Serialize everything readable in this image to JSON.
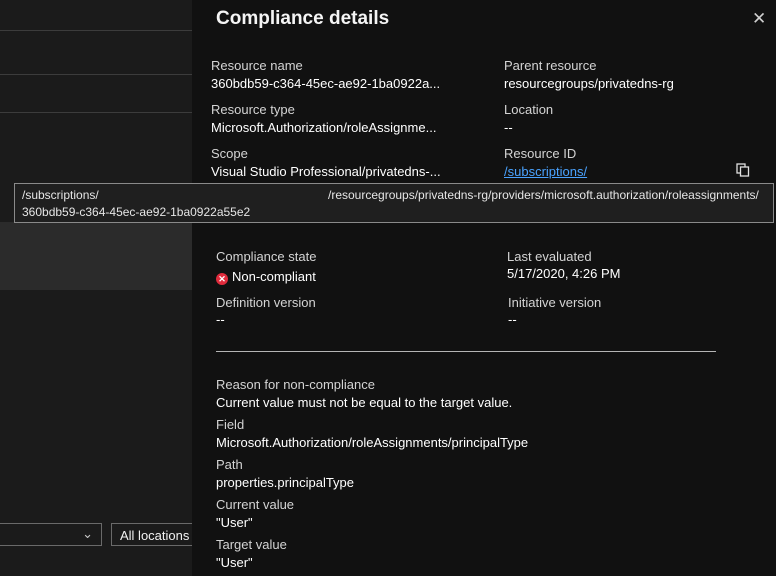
{
  "background": {
    "location_filter": "All locations"
  },
  "panel": {
    "title": "Compliance details",
    "resource_name_label": "Resource name",
    "resource_name_value": "360bdb59-c364-45ec-ae92-1ba0922a...",
    "parent_resource_label": "Parent resource",
    "parent_resource_value": "resourcegroups/privatedns-rg",
    "resource_type_label": "Resource type",
    "resource_type_value": "Microsoft.Authorization/roleAssignme...",
    "location_label": "Location",
    "location_value": "--",
    "scope_label": "Scope",
    "scope_value": "Visual Studio Professional/privatedns-...",
    "resource_id_label": "Resource ID",
    "resource_id_value": "/subscriptions/",
    "tooltip": {
      "part1": "/subscriptions/",
      "part2": "/resourcegroups/privatedns-rg/providers/microsoft.authorization/roleassignments/",
      "part3": "360bdb59-c364-45ec-ae92-1ba0922a55e2"
    },
    "compliance_state_label": "Compliance state",
    "compliance_state_value": "Non-compliant",
    "last_evaluated_label": "Last evaluated",
    "last_evaluated_value": "5/17/2020, 4:26 PM",
    "definition_version_label": "Definition version",
    "definition_version_value": "--",
    "initiative_version_label": "Initiative version",
    "initiative_version_value": "--",
    "reason_label": "Reason for non-compliance",
    "reason_value": "Current value must not be equal to the target value.",
    "field_label": "Field",
    "field_value": "Microsoft.Authorization/roleAssignments/principalType",
    "path_label": "Path",
    "path_value": "properties.principalType",
    "current_value_label": "Current value",
    "current_value_value": "\"User\"",
    "target_value_label": "Target value",
    "target_value_value": "\"User\""
  },
  "colors": {
    "non_compliant": "#e02b3c",
    "link": "#4aa3ff"
  },
  "icons": {
    "close": "close-icon",
    "copy": "copy-icon",
    "status": "error-icon",
    "dropdown": "chevron-down-icon"
  }
}
